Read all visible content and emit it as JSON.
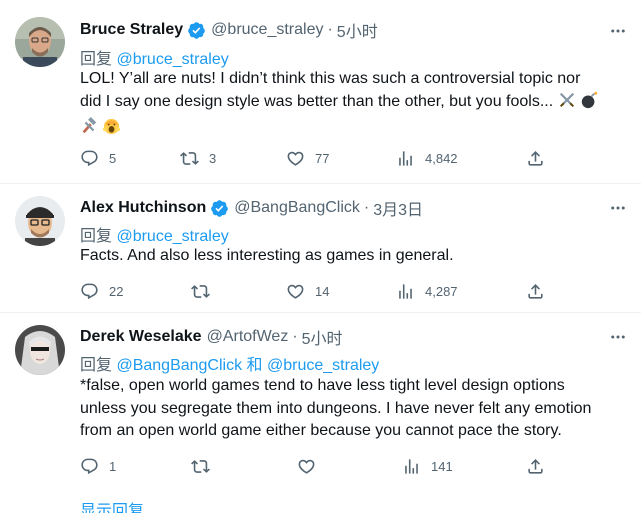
{
  "tweets": [
    {
      "name": "Bruce Straley",
      "handle": "@bruce_straley",
      "time": "5小时",
      "reply_prefix": "回复 ",
      "reply_to": [
        "@bruce_straley"
      ],
      "text_line1": "LOL! Y’all are nuts! I didn’t think this was such a controversial topic nor",
      "text_line2": "did I say one design style was better than the other, but you fools...",
      "emojis": [
        "crossed-swords-emoji",
        "bomb-emoji",
        "hammer-emoji",
        "screaming-face-emoji"
      ],
      "replies": "5",
      "retweets": "3",
      "likes": "77",
      "views": "4,842",
      "verified": true
    },
    {
      "name": "Alex Hutchinson",
      "handle": "@BangBangClick",
      "time": "3月3日",
      "reply_prefix": "回复 ",
      "reply_to": [
        "@bruce_straley"
      ],
      "text_line1": "Facts. And also less interesting as games in general.",
      "replies": "22",
      "retweets": "",
      "likes": "14",
      "views": "4,287",
      "verified": true
    },
    {
      "name": "Derek Weselake",
      "handle": "@ArtofWez",
      "time": "5小时",
      "reply_prefix": "回复 ",
      "reply_to": [
        "@BangBangClick",
        "@bruce_straley"
      ],
      "reply_joiner": " 和 ",
      "text_line1": "*false, open world games tend to have less tight level design options",
      "text_line2": "unless you segregate them into dungeons. I have never felt any emotion",
      "text_line3": "from an open world game either because you cannot pace the story.",
      "replies": "1",
      "retweets": "",
      "likes": "",
      "views": "141",
      "verified": false
    }
  ],
  "show_replies_label": "显示回复",
  "separator_dot": "·",
  "colors": {
    "accent": "#1d9bf0",
    "secondary_text": "#536471",
    "primary_text": "#0f1419",
    "divider": "#eff3f4"
  }
}
